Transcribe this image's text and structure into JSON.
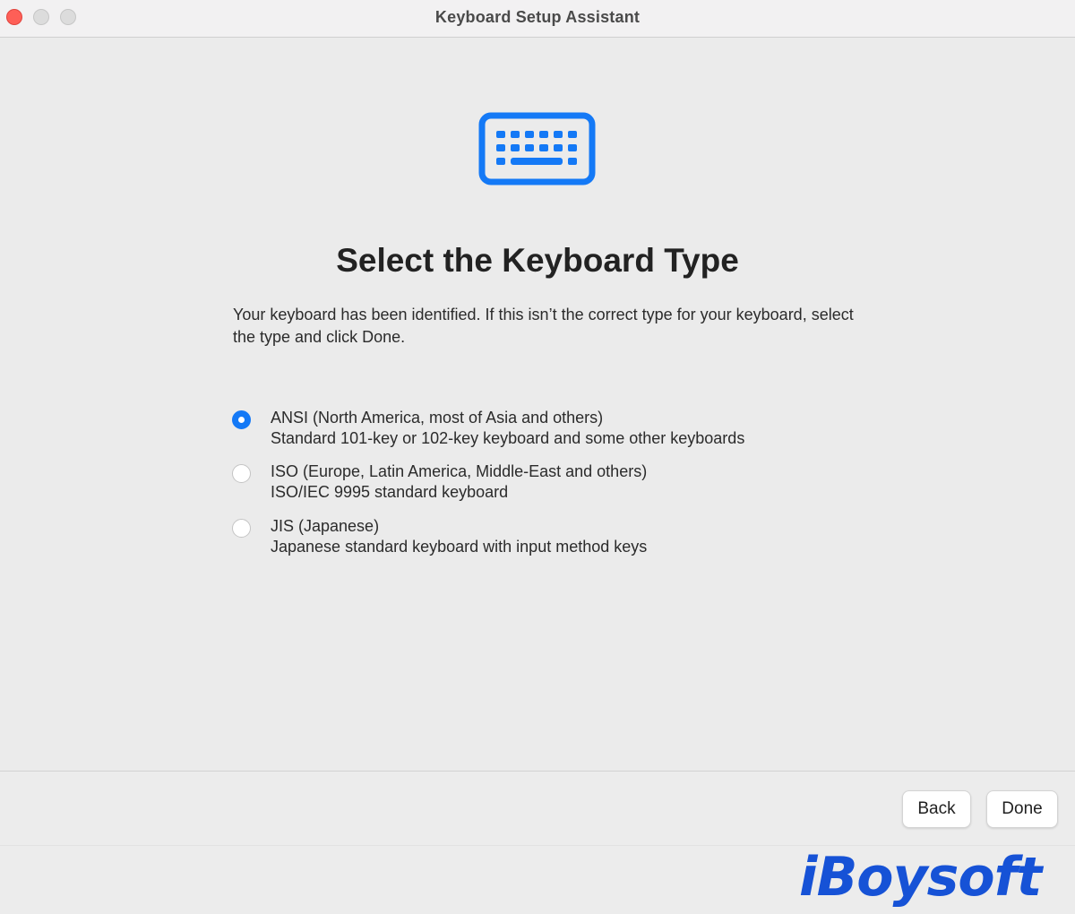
{
  "window": {
    "title": "Keyboard Setup Assistant"
  },
  "header": {
    "icon": "keyboard-icon",
    "title": "Select the Keyboard Type"
  },
  "intro": "Your keyboard has been identified. If this isn’t the correct type for your keyboard, select the type and click Done.",
  "options": [
    {
      "title": "ANSI (North America, most of Asia and others)",
      "description": "Standard 101-key or 102-key keyboard and some other keyboards",
      "selected": true
    },
    {
      "title": "ISO (Europe, Latin America, Middle-East and others)",
      "description": "ISO/IEC 9995 standard keyboard",
      "selected": false
    },
    {
      "title": "JIS (Japanese)",
      "description": "Japanese standard keyboard with input method keys",
      "selected": false
    }
  ],
  "buttons": {
    "back": "Back",
    "done": "Done"
  },
  "watermark": "iBoysoft",
  "colors": {
    "accent": "#1479f6",
    "close": "#fe5f57",
    "watermark": "#1652d6"
  }
}
